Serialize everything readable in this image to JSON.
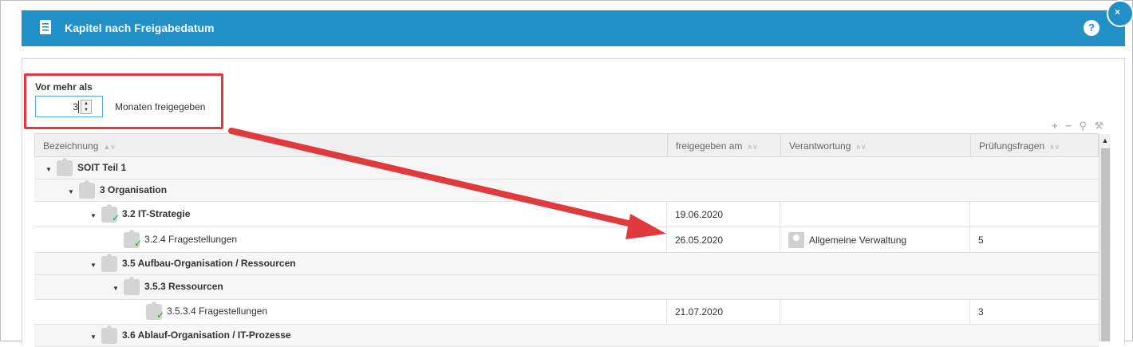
{
  "window": {
    "title": "Kapitel nach Freigabedatum",
    "help": "?",
    "close": "×"
  },
  "filter": {
    "label": "Vor mehr als",
    "value": "3",
    "suffix": "Monaten freigegeben",
    "spin_up": "▲",
    "spin_down": "▼"
  },
  "toolbar": {
    "icons": [
      "plus-icon",
      "minus-icon",
      "search-icon",
      "wrench-icon"
    ],
    "text": "+ − ⚲ ⚒"
  },
  "table": {
    "columns": [
      {
        "label": "Bezeichnung",
        "sort": "▲∨"
      },
      {
        "label": "freigegeben am",
        "sort": "∧∨"
      },
      {
        "label": "Verantwortung",
        "sort": "∧∨"
      },
      {
        "label": "Prüfungsfragen",
        "sort": "∧∨"
      }
    ],
    "rows": [
      {
        "name": "SOIT Teil 1",
        "level": 0,
        "expandable": true,
        "checked": false,
        "bold": true,
        "date": "",
        "owner": "",
        "questions": ""
      },
      {
        "name": "3 Organisation",
        "level": 1,
        "expandable": true,
        "checked": false,
        "bold": true,
        "date": "",
        "owner": "",
        "questions": ""
      },
      {
        "name": "3.2 IT-Strategie",
        "level": 2,
        "expandable": true,
        "checked": true,
        "bold": true,
        "date": "19.06.2020",
        "owner": "",
        "questions": ""
      },
      {
        "name": "3.2.4 Fragestellungen",
        "level": 3,
        "expandable": false,
        "checked": true,
        "bold": false,
        "date": "26.05.2020",
        "owner": "Allgemeine Verwaltung",
        "questions": "5"
      },
      {
        "name": "3.5 Aufbau-Organisation / Ressourcen",
        "level": 2,
        "expandable": true,
        "checked": false,
        "bold": true,
        "date": "",
        "owner": "",
        "questions": ""
      },
      {
        "name": "3.5.3 Ressourcen",
        "level": 3,
        "expandable": true,
        "checked": false,
        "bold": true,
        "date": "",
        "owner": "",
        "questions": ""
      },
      {
        "name": "3.5.3.4 Fragestellungen",
        "level": 4,
        "expandable": false,
        "checked": true,
        "bold": false,
        "date": "21.07.2020",
        "owner": "",
        "questions": "3"
      },
      {
        "name": "3.6 Ablauf-Organisation / IT-Prozesse",
        "level": 2,
        "expandable": true,
        "checked": false,
        "bold": true,
        "date": "",
        "owner": "",
        "questions": ""
      }
    ]
  },
  "colors": {
    "header": "#2190c6",
    "highlight": "#e03a3e",
    "check": "#1aa32a"
  }
}
